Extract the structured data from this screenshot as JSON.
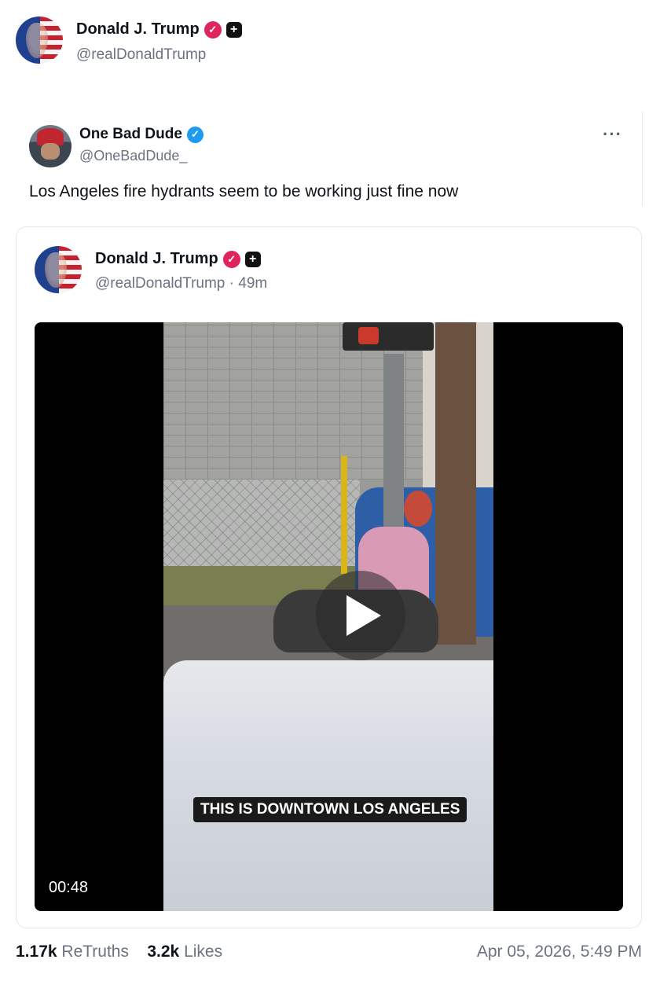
{
  "author": {
    "name": "Donald J. Trump",
    "handle": "@realDonaldTrump"
  },
  "reposted_post": {
    "name": "One Bad Dude",
    "handle": "@OneBadDude_",
    "more_icon": "ellipsis-icon",
    "text": "Los Angeles fire hydrants seem to be working just fine now"
  },
  "quoted_post": {
    "name": "Donald J. Trump",
    "handle_time": "@realDonaldTrump · 49m"
  },
  "video": {
    "caption": "THIS IS DOWNTOWN LOS ANGELES",
    "duration": "00:48",
    "play_icon": "play-icon"
  },
  "stats": {
    "retruths_count": "1.17k",
    "retruths_label": "ReTruths",
    "likes_count": "3.2k",
    "likes_label": "Likes"
  },
  "timestamp": "Apr 05, 2026, 5:49 PM",
  "colors": {
    "verified_pink": "#e0245e",
    "verified_blue": "#1d9bf0",
    "text_muted": "#6b7280"
  }
}
